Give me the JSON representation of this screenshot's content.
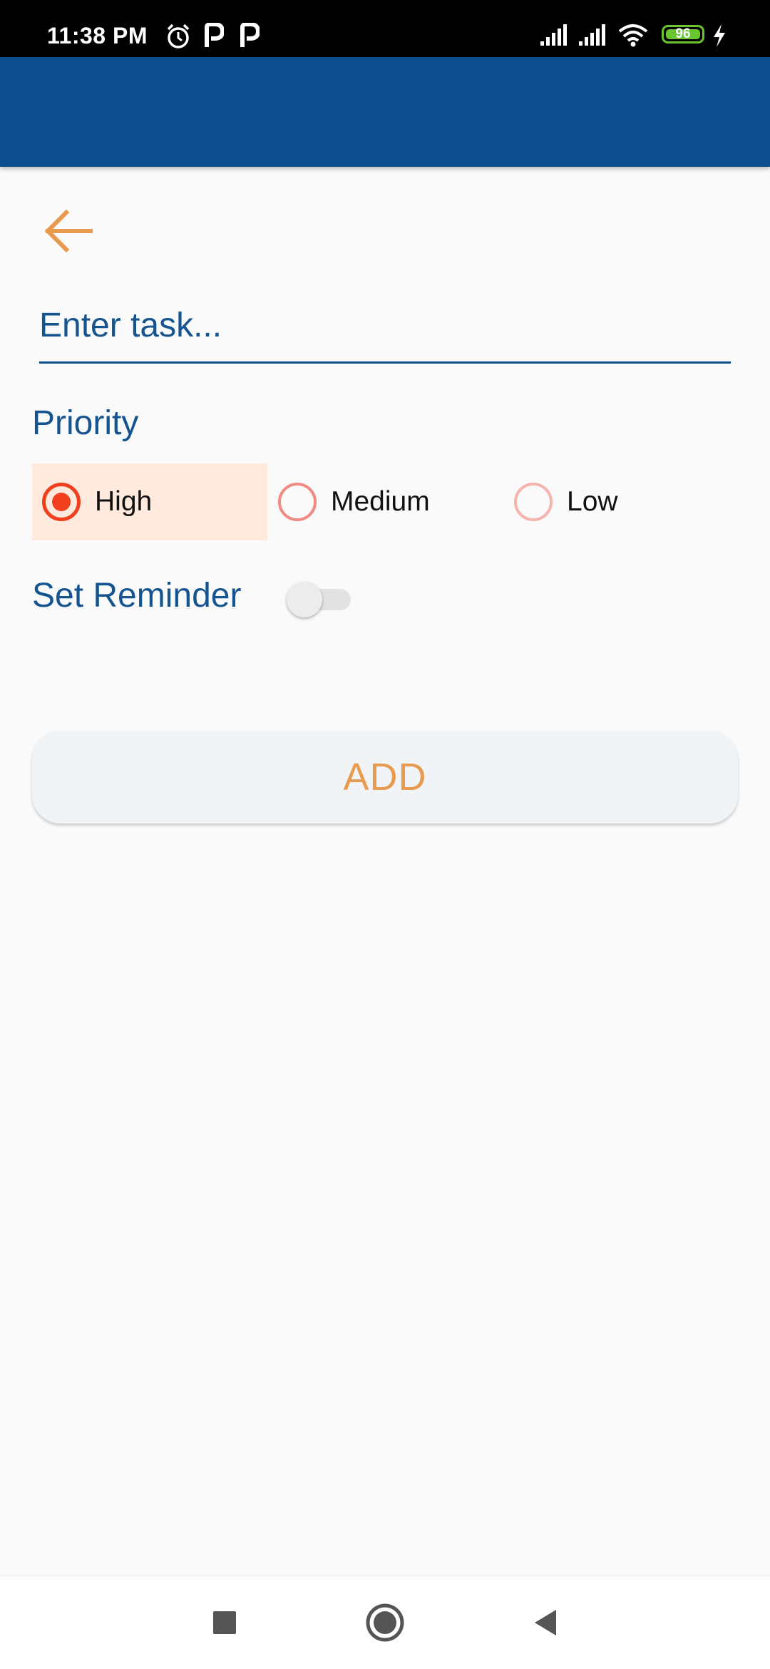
{
  "status_bar": {
    "time": "11:38 PM",
    "battery_level": "96",
    "icons": [
      "alarm-icon",
      "parking-app-icon",
      "parking-app-icon",
      "signal-icon",
      "signal-icon",
      "wifi-icon",
      "battery-icon",
      "charging-icon"
    ]
  },
  "form": {
    "task_placeholder": "Enter task...",
    "task_value": "",
    "priority_label": "Priority",
    "priority_options": [
      {
        "label": "High",
        "selected": true,
        "color": "#f0401e"
      },
      {
        "label": "Medium",
        "selected": false,
        "color": "#f08a82"
      },
      {
        "label": "Low",
        "selected": false,
        "color": "#f5b4ae"
      }
    ],
    "reminder_label": "Set Reminder",
    "reminder_on": false,
    "add_label": "ADD"
  },
  "colors": {
    "app_bar": "#0d4f8f",
    "accent": "#e89a4e",
    "label_text": "#15548f",
    "selected_bg": "#ffeadd"
  }
}
